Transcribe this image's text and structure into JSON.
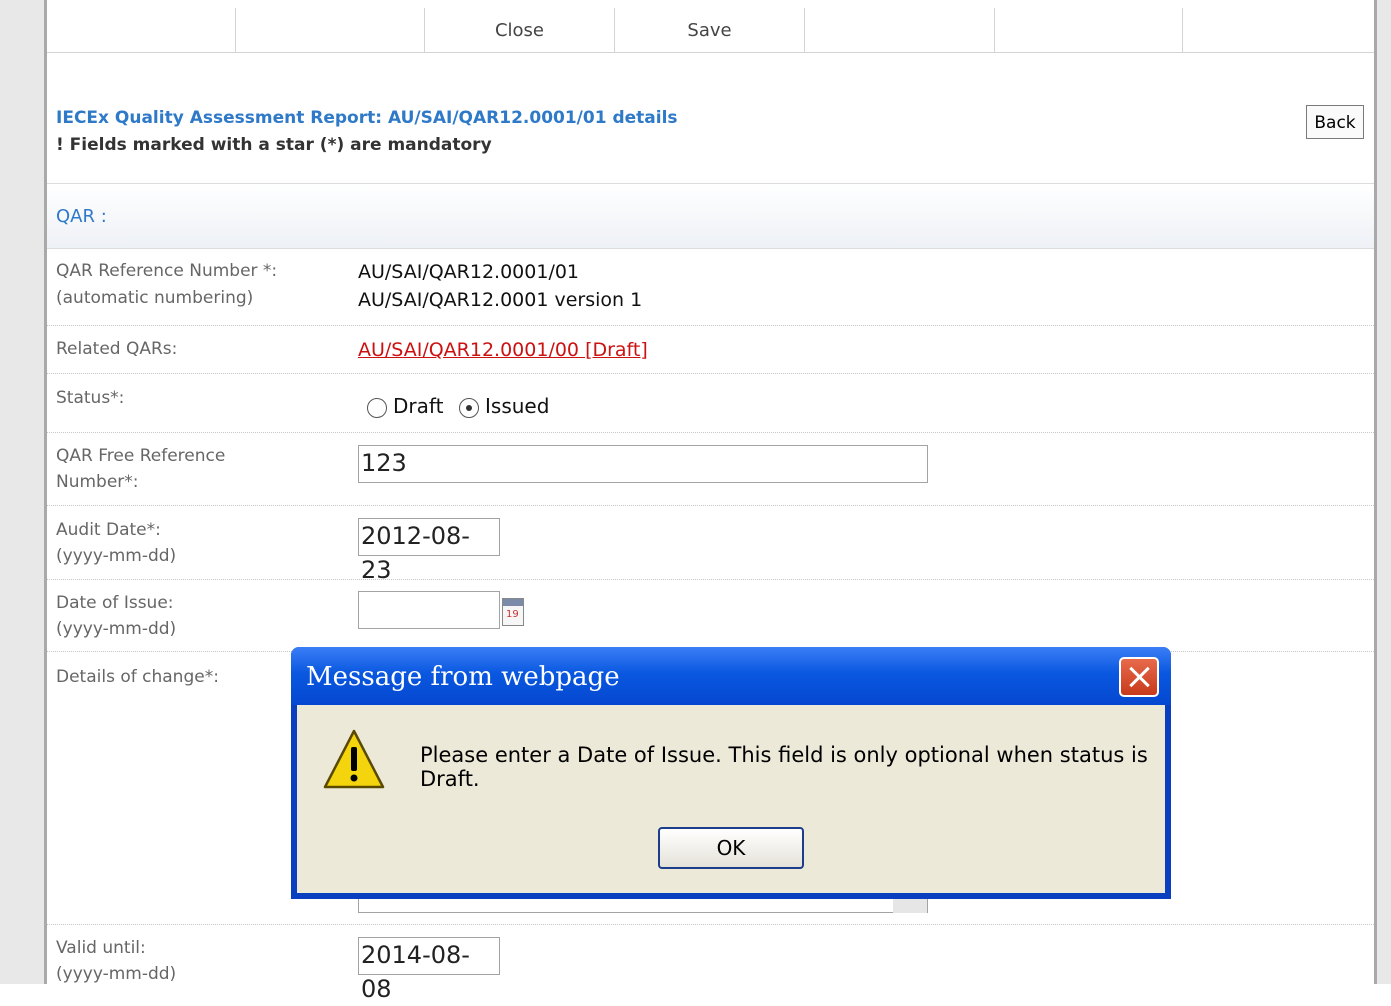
{
  "toolbar": {
    "close_label": "Close",
    "save_label": "Save"
  },
  "header": {
    "title": "IECEx Quality Assessment Report: AU/SAI/QAR12.0001/01 details",
    "note": "! Fields marked with a star (*) are mandatory",
    "back_label": "Back"
  },
  "section": {
    "title": "QAR :"
  },
  "form": {
    "ref_label": "QAR Reference Number *:",
    "ref_sublabel": "(automatic numbering)",
    "ref_value": "AU/SAI/QAR12.0001/01",
    "ref_version": "AU/SAI/QAR12.0001 version 1",
    "related_label": "Related QARs:",
    "related_link": "AU/SAI/QAR12.0001/00 [Draft]",
    "status_label": "Status*:",
    "status_options": [
      "Draft",
      "Issued"
    ],
    "status_selected": "Issued",
    "free_ref_label_1": "QAR Free Reference",
    "free_ref_label_2": "Number*:",
    "free_ref_value": "123",
    "audit_label": "Audit Date*:",
    "audit_format": "(yyyy-mm-dd)",
    "audit_value": "2012-08-23",
    "issue_label": "Date of Issue:",
    "issue_format": "(yyyy-mm-dd)",
    "issue_value": "",
    "details_label": "Details of change*:",
    "valid_label": "Valid until:",
    "valid_format": "(yyyy-mm-dd)",
    "valid_value": "2014-08-08",
    "calendar_icon_day": "19"
  },
  "dialog": {
    "title": "Message from webpage",
    "message": "Please enter a Date of Issue. This field is only optional when status is Draft.",
    "ok_label": "OK"
  },
  "colors": {
    "link": "#cc1111",
    "heading": "#2e79c8",
    "dialog_title": "#0a58e0"
  }
}
